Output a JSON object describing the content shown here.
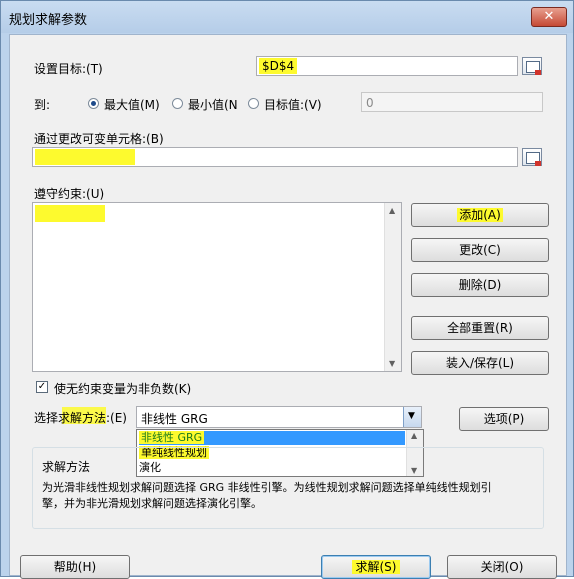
{
  "window": {
    "title": "规划求解参数",
    "close_glyph": "✕"
  },
  "objective": {
    "label": "设置目标:(T)",
    "value": "$D$4"
  },
  "to": {
    "label": "到:",
    "options": [
      {
        "label": "最大值(M)",
        "selected": true
      },
      {
        "label": "最小值(N",
        "selected": false
      },
      {
        "label": "目标值:(V)",
        "selected": false
      }
    ],
    "target_value": "0"
  },
  "changing_cells": {
    "label": "通过更改可变单元格:(B)",
    "value": ""
  },
  "constraints": {
    "label": "遵守约束:(U)",
    "items": [],
    "buttons": {
      "add": "添加(A)",
      "change": "更改(C)",
      "delete": "删除(D)",
      "reset_all": "全部重置(R)",
      "load_save": "装入/保存(L)"
    }
  },
  "nonneg": {
    "label": "使无约束变量为非负数(K)",
    "checked": true
  },
  "method": {
    "label": "选择求解方法:(E)",
    "selected": "非线性 GRG",
    "options": [
      "非线性 GRG",
      "单纯线性规划",
      "演化"
    ],
    "options_button": "选项(P)"
  },
  "solving_method": {
    "title": "求解方法",
    "description_line1": "为光滑非线性规划求解问题选择 GRG 非线性引擎。为线性规划求解问题选择单纯线性规划引",
    "description_line2": "擎，并为非光滑规划求解问题选择演化引擎。"
  },
  "footer": {
    "help": "帮助(H)",
    "solve": "求解(S)",
    "close": "关闭(O)"
  },
  "colors": {
    "highlight": "#fdfa2e",
    "selection": "#3399ff"
  }
}
